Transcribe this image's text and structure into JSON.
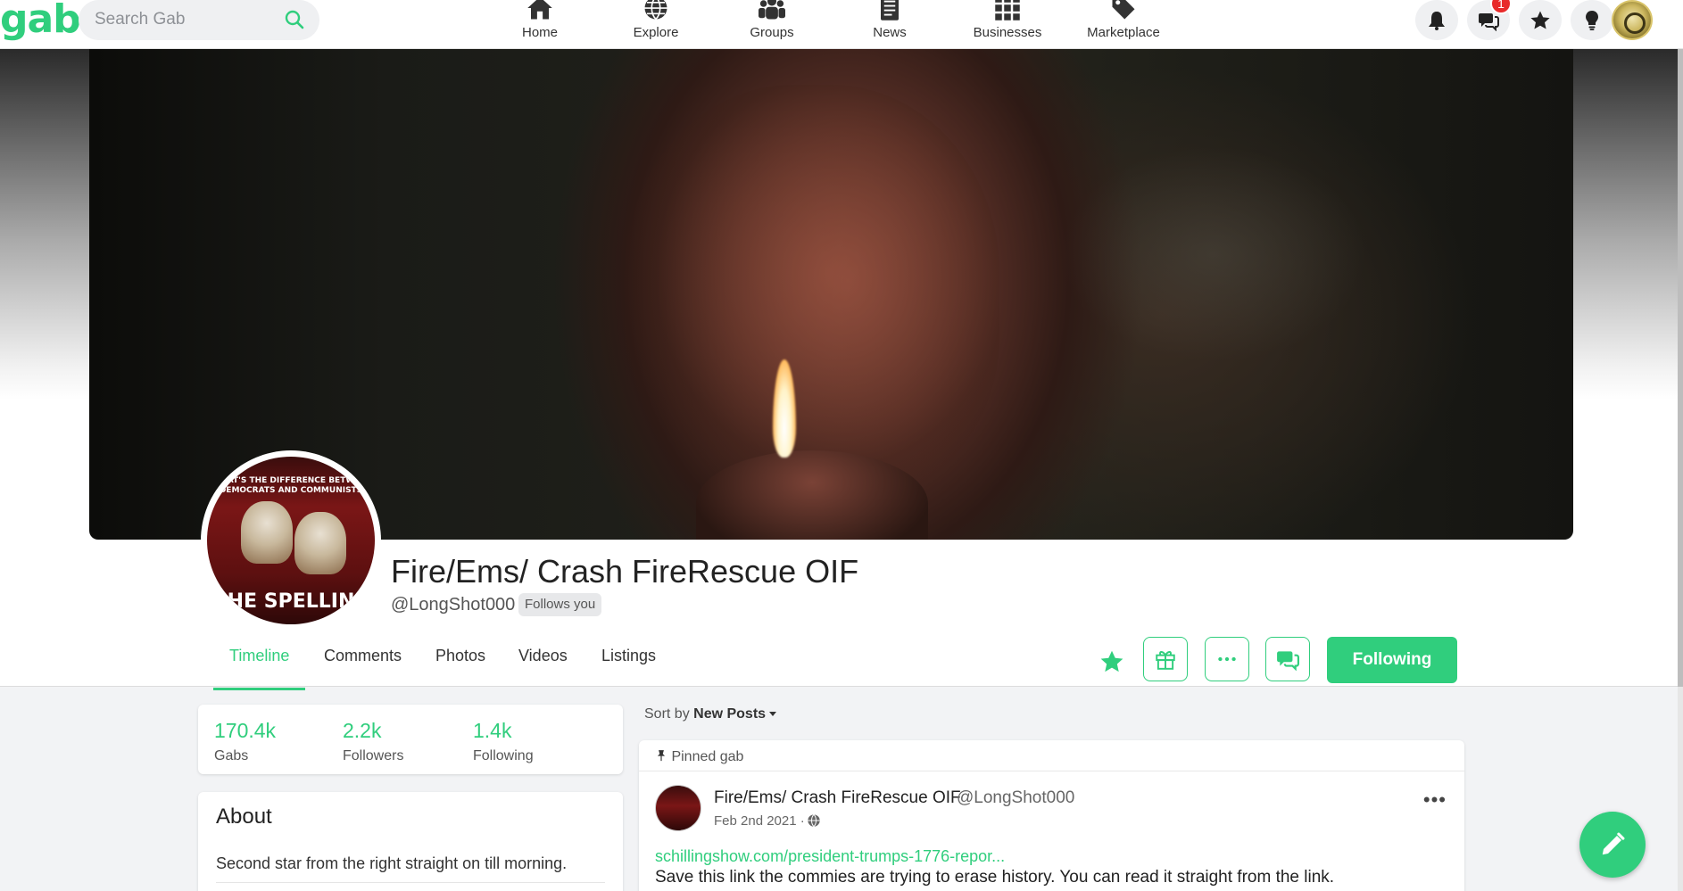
{
  "brand": {
    "logo": "gab",
    "accent": "#30ce7d"
  },
  "search": {
    "placeholder": "Search Gab"
  },
  "nav": {
    "items": [
      {
        "label": "Home",
        "icon": "home-icon"
      },
      {
        "label": "Explore",
        "icon": "globe-icon"
      },
      {
        "label": "Groups",
        "icon": "groups-icon"
      },
      {
        "label": "News",
        "icon": "news-icon"
      },
      {
        "label": "Businesses",
        "icon": "grid-icon"
      },
      {
        "label": "Marketplace",
        "icon": "tag-icon"
      }
    ],
    "right": {
      "notifications_icon": "bell-icon",
      "messages_icon": "chat-icon",
      "messages_badge": "1",
      "favorites_icon": "star-icon",
      "tips_icon": "lightbulb-icon"
    }
  },
  "profile": {
    "display_name": "Fire/Ems/ Crash FireRescue OIF",
    "handle": "@LongShot000",
    "follows_you": "Follows you",
    "avatar_top_text": "AT'S THE DIFFERENCE BETW DEMOCRATS AND COMMUNISTS",
    "avatar_bottom_text": "HE SPELLIN"
  },
  "tabs": [
    {
      "label": "Timeline",
      "active": true
    },
    {
      "label": "Comments",
      "active": false
    },
    {
      "label": "Photos",
      "active": false
    },
    {
      "label": "Videos",
      "active": false
    },
    {
      "label": "Listings",
      "active": false
    }
  ],
  "actions": {
    "favorite_icon": "star-icon",
    "gift_icon": "gift-icon",
    "more_icon": "ellipsis-icon",
    "chat_icon": "chat-icon",
    "following_label": "Following"
  },
  "stats": [
    {
      "value": "170.4k",
      "label": "Gabs"
    },
    {
      "value": "2.2k",
      "label": "Followers"
    },
    {
      "value": "1.4k",
      "label": "Following"
    }
  ],
  "about": {
    "title": "About",
    "bio": "Second star from the right straight on till morning."
  },
  "feed": {
    "sort_prefix": "Sort by",
    "sort_value": "New Posts",
    "post": {
      "pinned_label": "Pinned gab",
      "author_name": "Fire/Ems/ Crash FireRescue OIF",
      "author_handle": "@LongShot000",
      "date": "Feb 2nd 2021 ·",
      "link": "schillingshow.com/president-trumps-1776-repor...",
      "text": "Save this link the commies are trying to erase history. You can read it straight from the link."
    }
  },
  "compose": {
    "icon": "pencil-icon"
  }
}
